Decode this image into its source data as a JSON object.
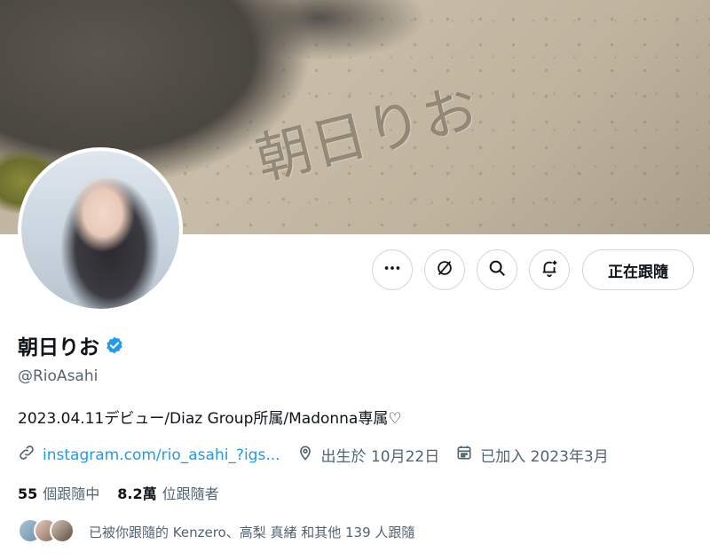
{
  "banner": {
    "sand_text": "朝日りお"
  },
  "actions": {
    "more_label": "更多",
    "follow_label": "正在跟隨"
  },
  "profile": {
    "display_name": "朝日りお",
    "handle": "@RioAsahi",
    "bio": "2023.04.11デビュー/Diaz Group所属/Madonna専属♡",
    "link_text": "instagram.com/rio_asahi_?igs...",
    "birthday": "出生於 10月22日",
    "joined": "已加入 2023年3月"
  },
  "stats": {
    "following_count": "55",
    "following_label": "個跟隨中",
    "followers_count": "8.2萬",
    "followers_label": "位跟隨者"
  },
  "mutuals": {
    "text": "已被你跟隨的 Kenzero、高梨 真緒 和其他 139 人跟隨"
  },
  "colors": {
    "accent": "#1d9bf0",
    "text_primary": "#0f1419",
    "text_secondary": "#536471",
    "border": "#cfd9de"
  },
  "icons": [
    "more-icon",
    "grok-icon",
    "search-icon",
    "notification-bell-icon",
    "verified-badge-icon",
    "link-icon",
    "location-pin-icon",
    "calendar-icon"
  ]
}
